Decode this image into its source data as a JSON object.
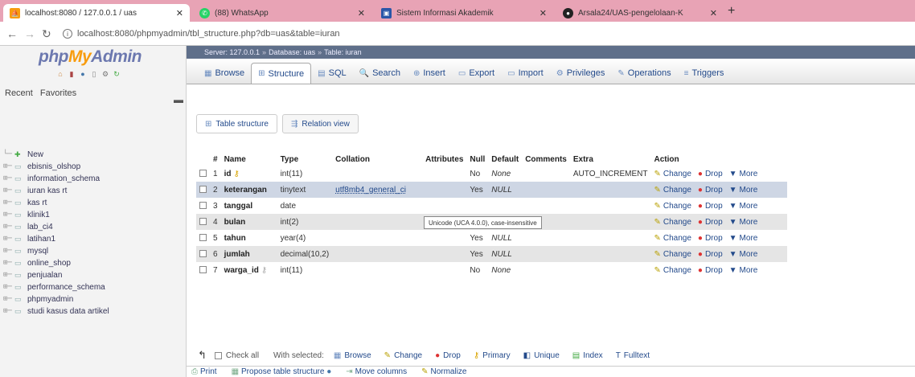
{
  "browser": {
    "tabs": [
      {
        "title": "localhost:8080 / 127.0.0.1 / uas",
        "close": "✕",
        "active": true
      },
      {
        "title": "(88) WhatsApp",
        "close": "✕",
        "active": false
      },
      {
        "title": "Sistem Informasi Akademik",
        "close": "✕",
        "active": false
      },
      {
        "title": "Arsala24/UAS-pengelolaan-K",
        "close": "✕",
        "active": false
      }
    ],
    "new_tab": "+",
    "url": "localhost:8080/phpmyadmin/tbl_structure.php?db=uas&table=iuran"
  },
  "sidebar": {
    "logo_a": "php",
    "logo_b": "My",
    "logo_c": "Admin",
    "recent_label": "Recent",
    "favorites_label": "Favorites",
    "new_label": "New",
    "databases": [
      "ebisnis_olshop",
      "information_schema",
      "iuran kas rt",
      "kas rt",
      "klinik1",
      "lab_ci4",
      "latihan1",
      "mysql",
      "online_shop",
      "penjualan",
      "performance_schema",
      "phpmyadmin",
      "studi kasus data artikel"
    ]
  },
  "breadcrumb": {
    "server": "Server: 127.0.0.1",
    "database": "Database: uas",
    "table": "Table: iuran"
  },
  "menu": [
    {
      "label": "Browse",
      "icon": "▦"
    },
    {
      "label": "Structure",
      "icon": "⊞"
    },
    {
      "label": "SQL",
      "icon": "▤"
    },
    {
      "label": "Search",
      "icon": "🔍"
    },
    {
      "label": "Insert",
      "icon": "⊕"
    },
    {
      "label": "Export",
      "icon": "▭"
    },
    {
      "label": "Import",
      "icon": "▭"
    },
    {
      "label": "Privileges",
      "icon": "⚙"
    },
    {
      "label": "Operations",
      "icon": "✎"
    },
    {
      "label": "Triggers",
      "icon": "≡"
    }
  ],
  "subtabs": {
    "table_structure": "Table structure",
    "relation_view": "Relation view"
  },
  "table": {
    "headers": [
      "#",
      "Name",
      "Type",
      "Collation",
      "Attributes",
      "Null",
      "Default",
      "Comments",
      "Extra",
      "Action"
    ],
    "rows": [
      {
        "num": "1",
        "name": "id",
        "type": "int(11)",
        "collation": "",
        "attributes": "",
        "null": "No",
        "default": "None",
        "comments": "",
        "extra": "AUTO_INCREMENT"
      },
      {
        "num": "2",
        "name": "keterangan",
        "type": "tinytext",
        "collation": "utf8mb4_general_ci",
        "attributes": "",
        "null": "Yes",
        "default": "NULL",
        "comments": "",
        "extra": ""
      },
      {
        "num": "3",
        "name": "tanggal",
        "type": "date",
        "collation": "",
        "attributes": "",
        "null": "",
        "default": "",
        "comments": "",
        "extra": ""
      },
      {
        "num": "4",
        "name": "bulan",
        "type": "int(2)",
        "collation": "",
        "attributes": "",
        "null": "Yes",
        "default": "NULL",
        "comments": "",
        "extra": ""
      },
      {
        "num": "5",
        "name": "tahun",
        "type": "year(4)",
        "collation": "",
        "attributes": "",
        "null": "Yes",
        "default": "NULL",
        "comments": "",
        "extra": ""
      },
      {
        "num": "6",
        "name": "jumlah",
        "type": "decimal(10,2)",
        "collation": "",
        "attributes": "",
        "null": "Yes",
        "default": "NULL",
        "comments": "",
        "extra": ""
      },
      {
        "num": "7",
        "name": "warga_id",
        "type": "int(11)",
        "collation": "",
        "attributes": "",
        "null": "No",
        "default": "None",
        "comments": "",
        "extra": ""
      }
    ],
    "action_change": "Change",
    "action_drop": "Drop",
    "action_more": "More",
    "tooltip": "Unicode (UCA 4.0.0), case-insensitive"
  },
  "bulk": {
    "check_all": "Check all",
    "with_selected": "With selected:",
    "browse": "Browse",
    "change": "Change",
    "drop": "Drop",
    "primary": "Primary",
    "unique": "Unique",
    "index": "Index",
    "fulltext": "Fulltext"
  },
  "footer": {
    "print": "Print",
    "propose": "Propose table structure",
    "move_columns": "Move columns",
    "normalize": "Normalize"
  }
}
